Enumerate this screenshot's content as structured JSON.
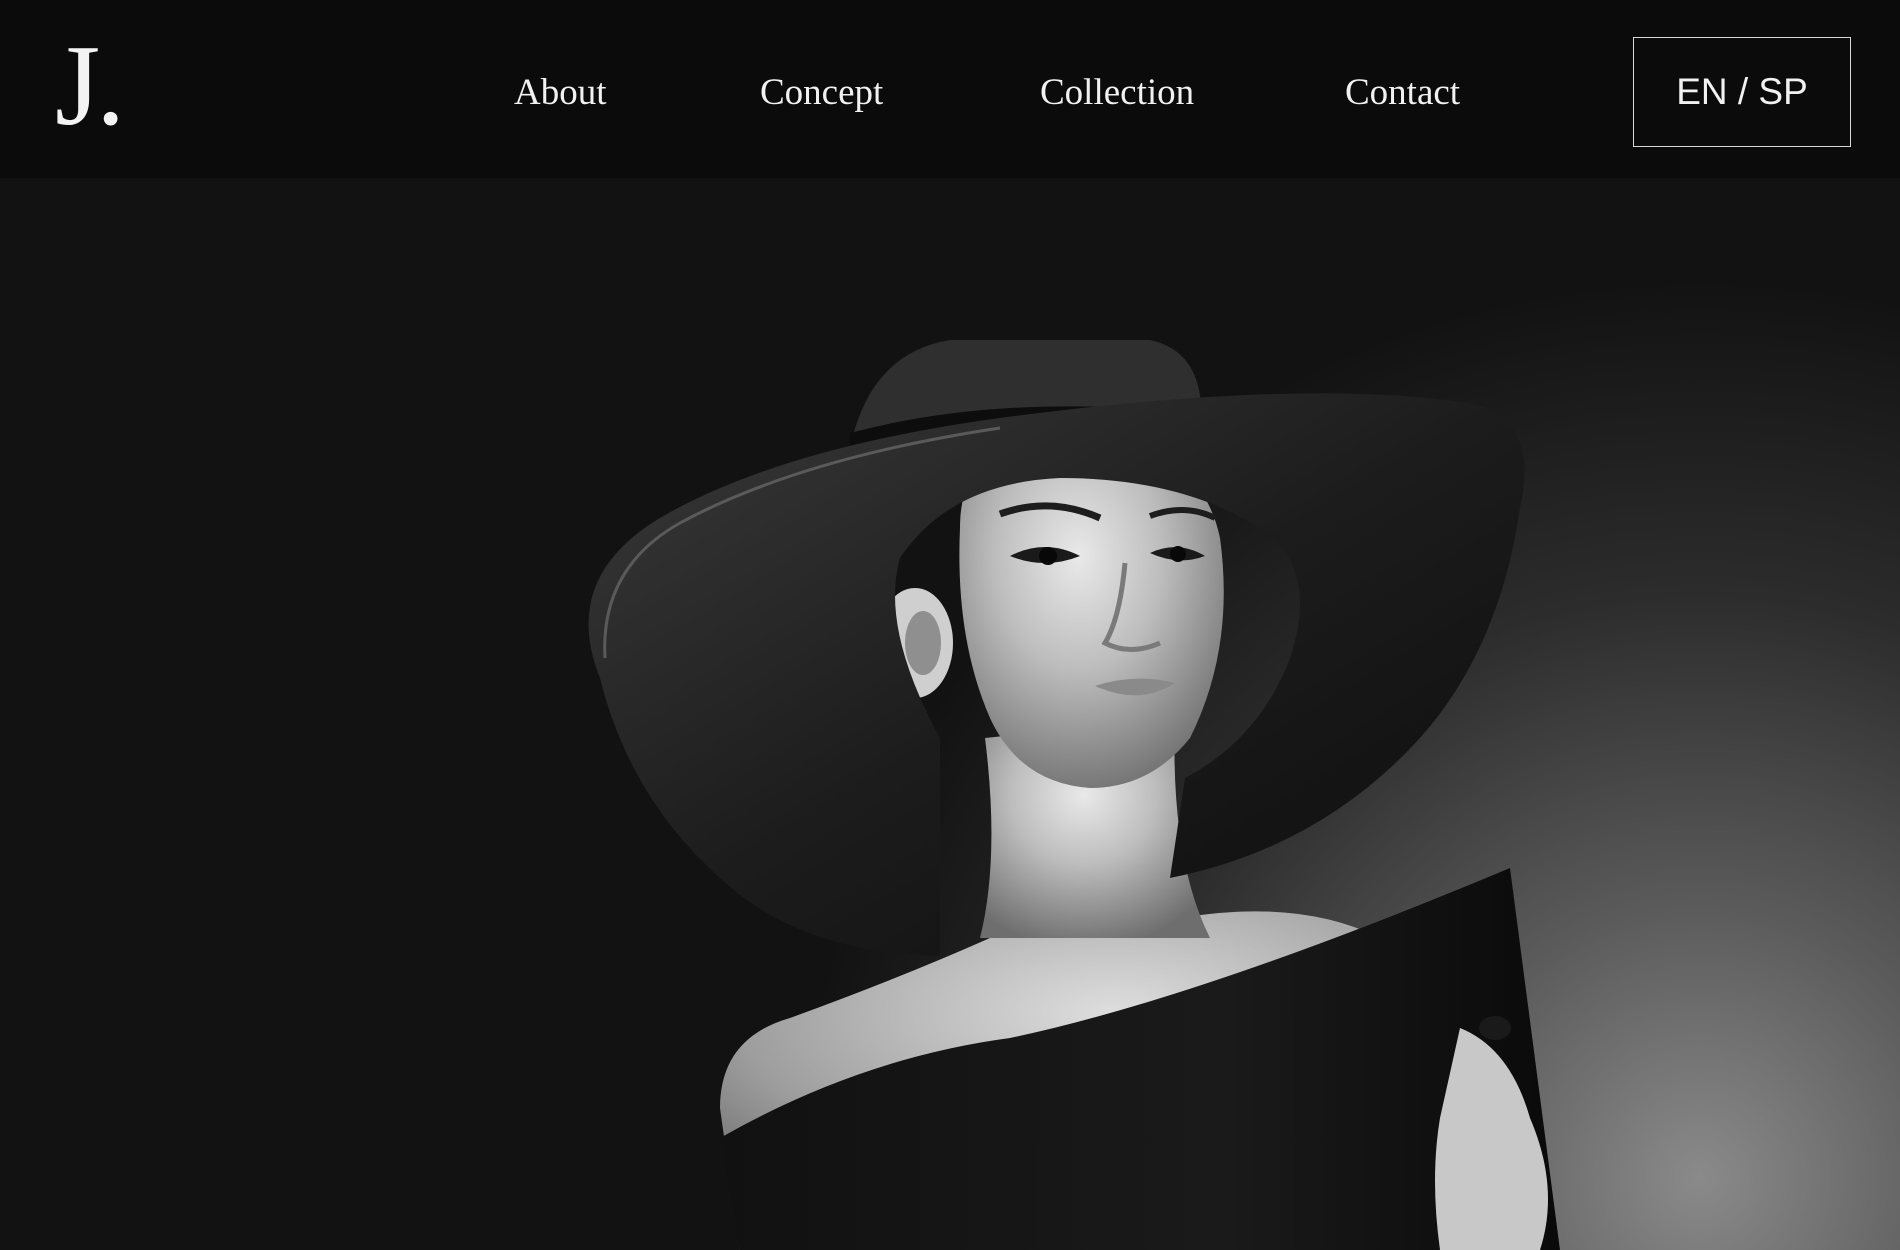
{
  "logo": {
    "text": "J."
  },
  "nav": {
    "about": "About",
    "concept": "Concept",
    "collection": "Collection",
    "contact": "Contact"
  },
  "language_switch": {
    "label": "EN / SP"
  },
  "hero": {
    "image_subject": "woman-wide-brim-hat-portrait",
    "tagline": ""
  },
  "colors": {
    "header_bg": "#0b0b0b",
    "text": "#f1f1f1",
    "border": "#d9d9d9"
  }
}
